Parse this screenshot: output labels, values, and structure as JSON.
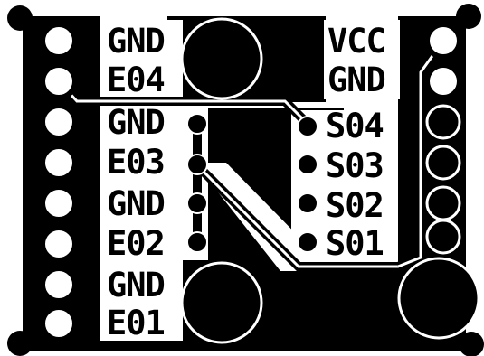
{
  "board": {
    "colors": {
      "copper": "#000000",
      "substrate": "#ffffff",
      "trace": "#ffffff"
    },
    "left_header": {
      "labels": [
        "GND",
        "E04",
        "GND",
        "E03",
        "GND",
        "E02",
        "GND",
        "E01"
      ]
    },
    "right_header": {
      "labels": [
        "VCC",
        "GND"
      ]
    },
    "sensor_pads": {
      "labels": [
        "S04",
        "S03",
        "S02",
        "S01"
      ]
    },
    "left_header_pin_count": 8,
    "right_header_pin_count": 6,
    "mounting_holes": 3
  }
}
